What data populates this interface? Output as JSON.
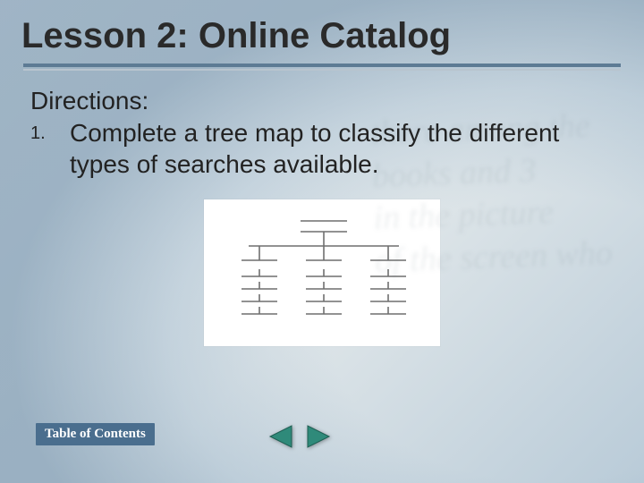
{
  "title": "Lesson 2: Online Catalog",
  "directions_label": "Directions:",
  "items": [
    {
      "number": "1.",
      "text": "Complete a tree map to classify the different types of searches available."
    }
  ],
  "toc_label": "Table of Contents",
  "nav": {
    "prev_name": "previous-slide",
    "next_name": "next-slide"
  },
  "colors": {
    "accent": "#4a6e8e",
    "nav_arrow": "#2f8a7a"
  }
}
